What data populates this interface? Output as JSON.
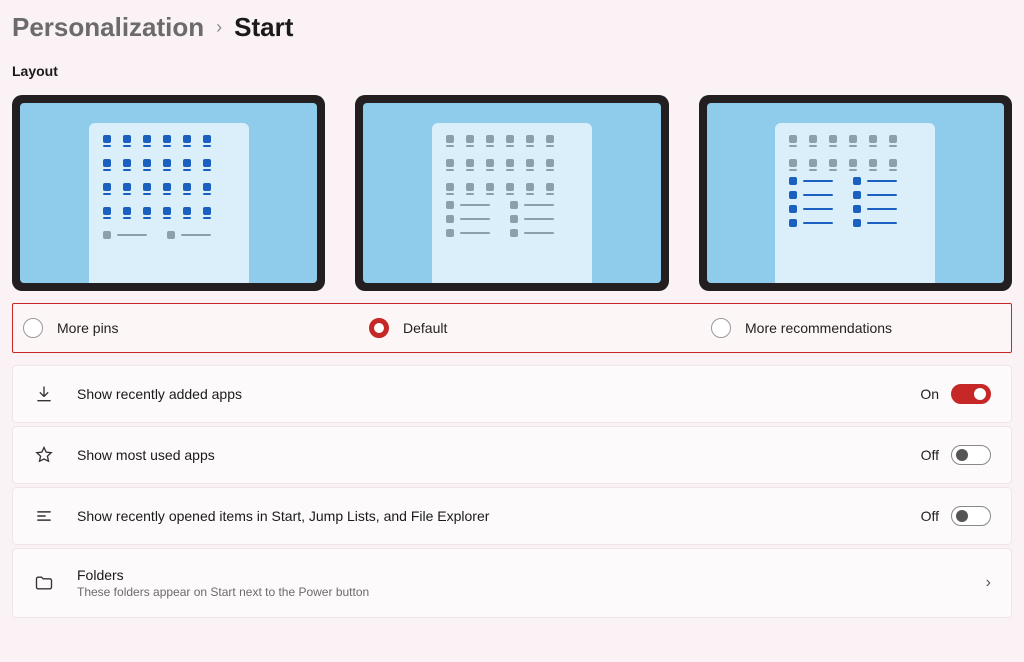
{
  "breadcrumb": {
    "parent": "Personalization",
    "current": "Start"
  },
  "section_label": "Layout",
  "layout_options": [
    {
      "id": "more_pins",
      "label": "More pins",
      "selected": false
    },
    {
      "id": "default",
      "label": "Default",
      "selected": true
    },
    {
      "id": "more_recs",
      "label": "More recommendations",
      "selected": false
    }
  ],
  "settings": {
    "recently_added": {
      "label": "Show recently added apps",
      "state": "On",
      "on": true
    },
    "most_used": {
      "label": "Show most used apps",
      "state": "Off",
      "on": false
    },
    "recently_opened": {
      "label": "Show recently opened items in Start, Jump Lists, and File Explorer",
      "state": "Off",
      "on": false
    },
    "folders": {
      "label": "Folders",
      "sub": "These folders appear on Start next to the Power button"
    }
  },
  "colors": {
    "accent": "#c62828"
  }
}
